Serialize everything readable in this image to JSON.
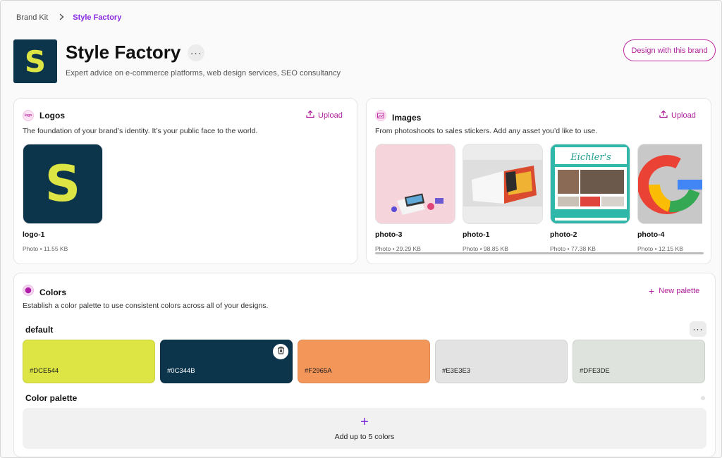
{
  "breadcrumb": {
    "root": "Brand Kit",
    "current": "Style Factory"
  },
  "brand": {
    "logo_letter": "S",
    "title": "Style Factory",
    "more": "···",
    "description": "Expert advice on e-commerce platforms, web design services, SEO consultancy",
    "design_button": "Design with this brand"
  },
  "logos": {
    "icon_text": "logo",
    "title": "Logos",
    "upload": "Upload",
    "subtitle": "The foundation of your brand’s identity. It’s your public face to the world.",
    "items": [
      {
        "name": "logo-1",
        "meta": "Photo • 11.55 KB",
        "letter": "S"
      }
    ]
  },
  "images": {
    "title": "Images",
    "upload": "Upload",
    "subtitle": "From photoshoots to sales stickers. Add any asset you’d like to use.",
    "items": [
      {
        "name": "photo-3",
        "meta": "Photo • 29.29 KB"
      },
      {
        "name": "photo-1",
        "meta": "Photo • 98.85 KB"
      },
      {
        "name": "photo-2",
        "meta": "Photo • 77.38 KB",
        "sign": "Eichler's"
      },
      {
        "name": "photo-4",
        "meta": "Photo • 12.15 KB"
      }
    ]
  },
  "colors": {
    "title": "Colors",
    "new_palette": "New palette",
    "subtitle": "Establish a color palette to use consistent colors across all of your designs.",
    "palette_name": "default",
    "palette_more": "···",
    "swatches": [
      {
        "label": "#DCE544",
        "hex": "#DCE544",
        "text_color": "#1a1a1a"
      },
      {
        "label": "#0C344B",
        "hex": "#0C344B",
        "text_color": "#ffffff"
      },
      {
        "label": "#F2965A",
        "hex": "#F2965A",
        "text_color": "#1a1a1a"
      },
      {
        "label": "#E3E3E3",
        "hex": "#E3E3E3",
        "text_color": "#1a1a1a"
      },
      {
        "label": "#DFE3DE",
        "hex": "#DFE3DE",
        "text_color": "#1a1a1a"
      }
    ],
    "section_label": "Color palette",
    "add_plus": "+",
    "add_text": "Add up to 5 colors"
  },
  "accent": "#B0209A"
}
